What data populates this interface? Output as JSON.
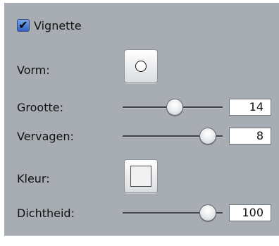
{
  "vignette": {
    "enabled": true,
    "label": "Vignette",
    "check_glyph": "✔"
  },
  "controls": {
    "shape": {
      "label": "Vorm:",
      "icon": "circle-shape-icon"
    },
    "size": {
      "label": "Grootte:",
      "value": "14",
      "slider_fraction": 0.52
    },
    "fade": {
      "label": "Vervagen:",
      "value": "8",
      "slider_fraction": 0.85
    },
    "color": {
      "label": "Kleur:",
      "swatch_color": "#f1f1f1"
    },
    "density": {
      "label": "Dichtheid:",
      "value": "100",
      "slider_fraction": 0.85
    }
  }
}
